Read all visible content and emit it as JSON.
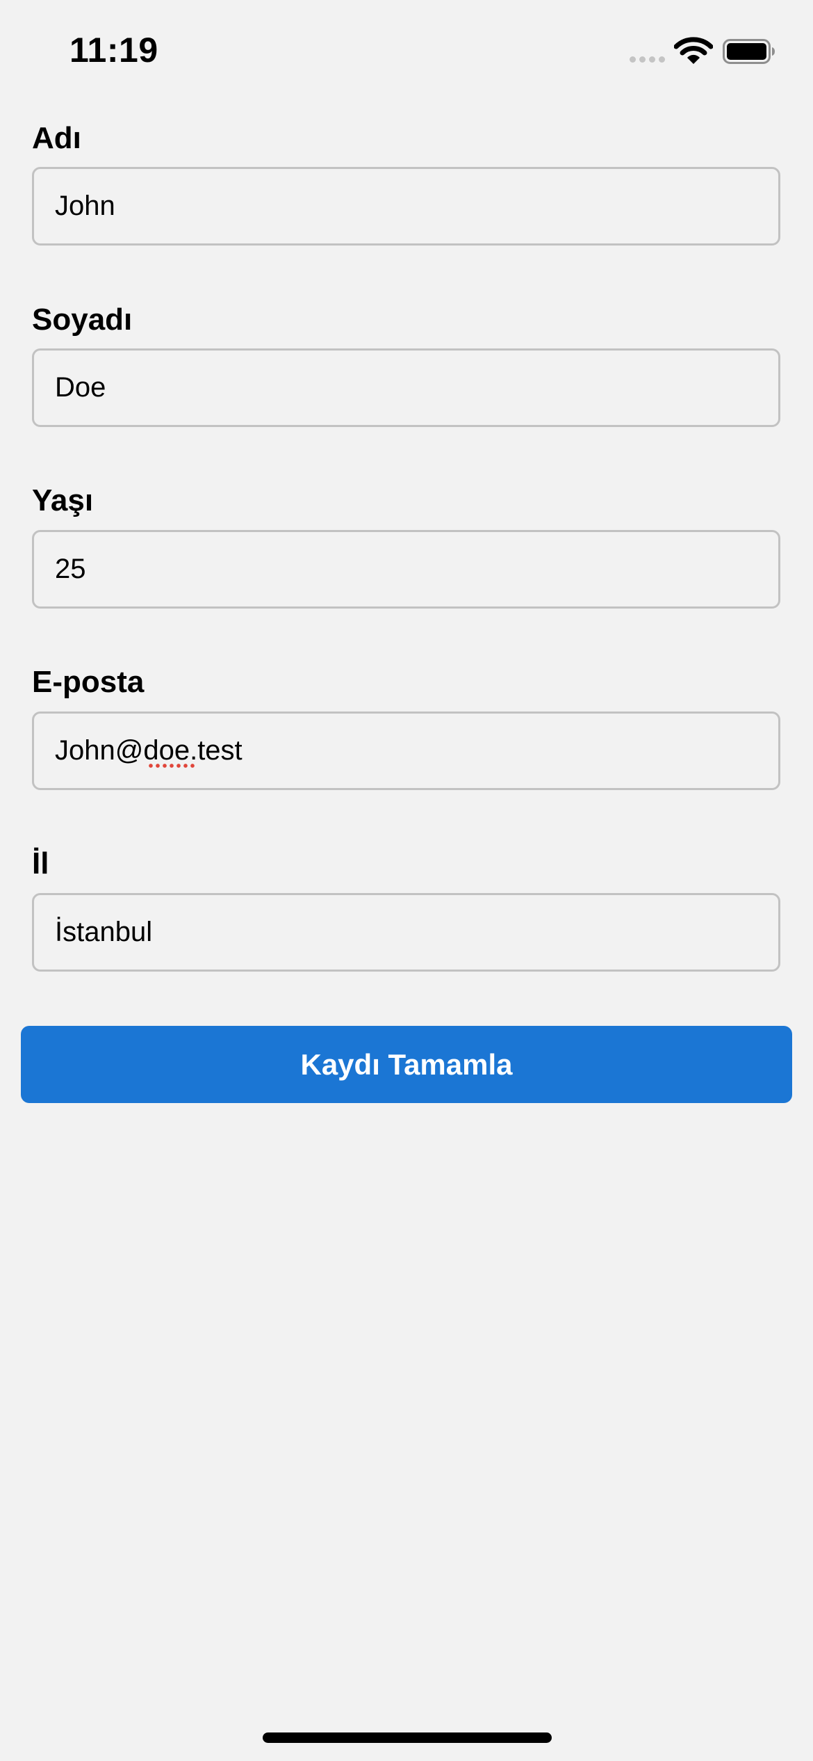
{
  "status_bar": {
    "time": "11:19",
    "icons": [
      "cellular-signal-icon",
      "wifi-icon",
      "battery-icon"
    ]
  },
  "form": {
    "fields": [
      {
        "label": "Adı",
        "value": "John"
      },
      {
        "label": "Soyadı",
        "value": "Doe"
      },
      {
        "label": "Yaşı",
        "value": "25"
      },
      {
        "label": "E-posta",
        "value": "John@doe.test",
        "spellcheck_flag": "doe"
      },
      {
        "label": "İl",
        "value": "İstanbul"
      }
    ],
    "submit_label": "Kaydı Tamamla"
  },
  "colors": {
    "background": "#f2f2f2",
    "input_border": "#c2c2c2",
    "button": "#1b76d4",
    "button_text": "#ffffff",
    "spellcheck": "#e0463a"
  }
}
